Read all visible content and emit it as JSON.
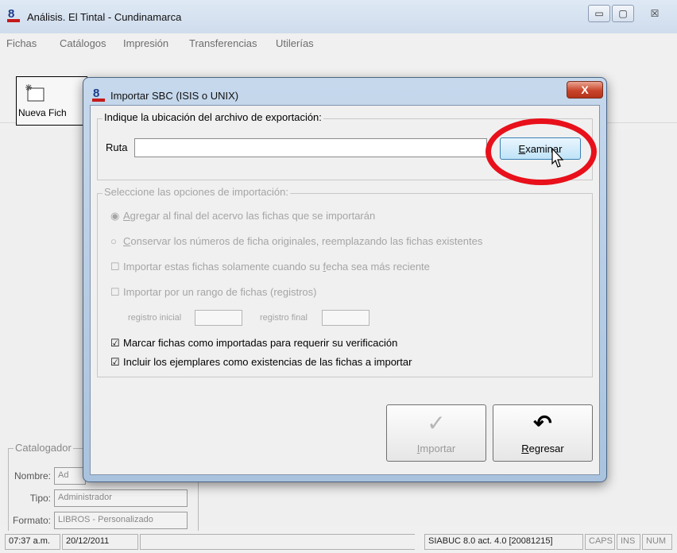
{
  "main_window": {
    "title": "Análisis. El Tintal - Cundinamarca",
    "controls": {
      "minimize": "▭",
      "maximize": "▢",
      "close": "☒"
    }
  },
  "menu": [
    "Fichas",
    "Catálogos",
    "Impresión",
    "Transferencias",
    "Utilerías"
  ],
  "toolbar": {
    "new_button_label": "Nueva Fich"
  },
  "background_panel": {
    "group_title": "Catalogador",
    "name_label": "Nombre:",
    "name_value": "Ad",
    "type_label": "Tipo:",
    "type_value": "Administrador",
    "format_label": "Formato:",
    "format_value": "LIBROS - Personalizado"
  },
  "status_bar": {
    "time": "07:37 a.m.",
    "date": "20/12/2011",
    "version": "SIABUC 8.0 act. 4.0 [20081215]",
    "caps": "CAPS",
    "ins": "INS",
    "num": "NUM"
  },
  "dialog": {
    "title": "Importar SBC (ISIS o UNIX)",
    "close_label": "X",
    "location_group_title": "Indique la ubicación del archivo de exportación:",
    "ruta_label": "Ruta",
    "ruta_value": "",
    "browse_prefix": "",
    "browse_key": "E",
    "browse_suffix": "xaminar",
    "options_group_title": "Seleccione las opciones de importación:",
    "radio_marks": {
      "selected": "◉",
      "unselected": "○"
    },
    "checkbox_marks": {
      "checked": "☑",
      "unchecked": "☐"
    },
    "options": {
      "append_key": "A",
      "append_rest": "gregar al final del acervo las fichas que se importarán",
      "preserve_key": "C",
      "preserve_rest": "onservar los números de ficha originales, reemplazando las fichas existentes",
      "recent_before": "Importar estas fichas solamente cuando su ",
      "recent_key": "f",
      "recent_after": "echa sea más reciente",
      "range_label": "Importar por un rango de fichas (registros)",
      "start_label": "registro inicial",
      "end_label": "registro final",
      "mark_label": "Marcar fichas como importadas para requerir su verificación",
      "include_label": "Incluir los ejemplares como existencias de las fichas a importar"
    },
    "import_button": {
      "glyph": "✓",
      "key": "I",
      "rest": "mportar"
    },
    "return_button": {
      "glyph": "↶",
      "key": "R",
      "rest": "egresar"
    }
  }
}
